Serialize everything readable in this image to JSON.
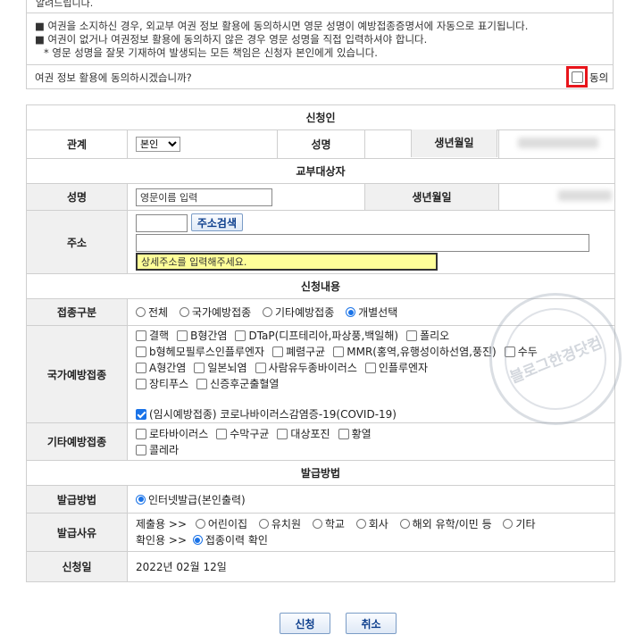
{
  "notice": {
    "top_text": "알려드립니다.",
    "line1": "■ 여권을 소지하신 경우, 외교부 여권 정보 활용에 동의하시면 영문 성명이 예방접종증명서에 자동으로 표기됩니다.",
    "line2": "■ 여권이 없거나 여권정보 활용에 동의하지 않은 경우 영문 성명을 직접 입력하셔야 합니다.",
    "line3": "* 영문 성명을 잘못 기재하여 발생되는 모든 책임은 신청자 본인에게 있습니다.",
    "consent_question": "여권 정보 활용에 동의하시겠습니까?",
    "consent_label": "동의"
  },
  "applicant": {
    "section_title": "신청인",
    "relation_label": "관계",
    "relation_value": "본인",
    "name_label": "성명",
    "birth_label": "생년월일"
  },
  "recipient": {
    "section_title": "교부대상자",
    "name_label": "성명",
    "name_placeholder": "영문이름 입력",
    "birth_label": "생년월일",
    "address_label": "주소",
    "address_search_button": "주소검색",
    "address_detail_placeholder": "상세주소를 입력해주세요."
  },
  "application": {
    "section_title": "신청내용",
    "type_label": "접종구분",
    "type_options": [
      {
        "label": "전체",
        "selected": false
      },
      {
        "label": "국가예방접종",
        "selected": false
      },
      {
        "label": "기타예방접종",
        "selected": false
      },
      {
        "label": "개별선택",
        "selected": true
      }
    ],
    "national_label": "국가예방접종",
    "national_rows": [
      [
        "결핵",
        "B형간염",
        "DTaP(디프테리아,파상풍,백일해)",
        "폴리오"
      ],
      [
        "b형헤모필루스인플루엔자",
        "폐렴구균",
        "MMR(홍역,유행성이하선염,풍진)",
        "수두"
      ],
      [
        "A형간염",
        "일본뇌염",
        "사람유두종바이러스",
        "인플루엔자"
      ],
      [
        "장티푸스",
        "신증후군출혈열"
      ]
    ],
    "covid_label": "(임시예방접종) 코로나바이러스감염증-19(COVID-19)",
    "covid_checked": true,
    "other_label": "기타예방접종",
    "other_rows": [
      [
        "로타바이러스",
        "수막구균",
        "대상포진",
        "황열"
      ],
      [
        "콜레라"
      ]
    ]
  },
  "issuance": {
    "section_title": "발급방법",
    "method_label": "발급방법",
    "method_option": "인터넷발급(본인출력)",
    "reason_label": "발급사유",
    "submit_prefix": "제출용 >>",
    "submit_options": [
      "어린이집",
      "유치원",
      "학교",
      "회사",
      "해외 유학/이민 등",
      "기타"
    ],
    "confirm_prefix": "확인용 >>",
    "confirm_option": "접종이력 확인",
    "date_label": "신청일",
    "date_value": "2022년 02월 12일"
  },
  "buttons": {
    "apply": "신청",
    "cancel": "취소"
  },
  "watermark": "블로그한경닷컴"
}
